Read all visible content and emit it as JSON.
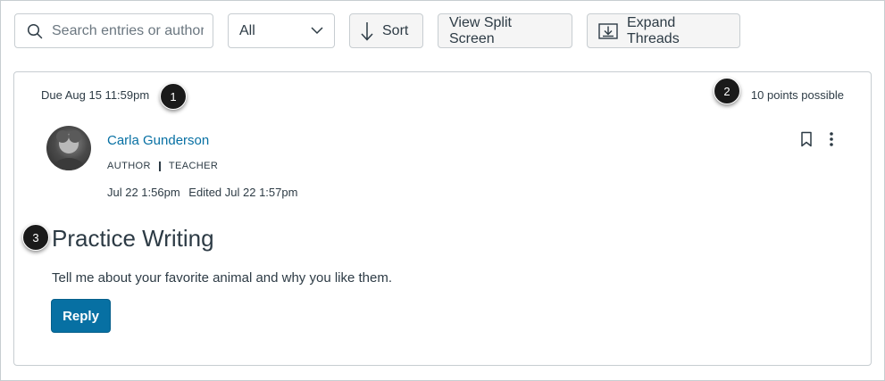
{
  "toolbar": {
    "search_placeholder": "Search entries or author",
    "filter_value": "All",
    "sort_label": "Sort",
    "split_label": "View Split Screen",
    "expand_label": "Expand Threads"
  },
  "topic": {
    "due": "Due Aug 15 11:59pm",
    "points": "10 points possible",
    "author_name": "Carla Gunderson",
    "role_author": "AUTHOR",
    "role_teacher": "TEACHER",
    "posted": "Jul 22 1:56pm",
    "edited": "Edited Jul 22 1:57pm",
    "title": "Practice Writing",
    "message": "Tell me about your favorite animal and why you like them.",
    "reply_label": "Reply"
  },
  "callouts": [
    "1",
    "2",
    "3"
  ],
  "colors": {
    "accent": "#0770a3",
    "text": "#2d3b45",
    "border": "#c7cdd1",
    "button_bg": "#f5f5f5"
  },
  "icons": {
    "search": "search-icon",
    "chevron": "chevron-down-icon",
    "sort": "arrow-down-icon",
    "expand": "expand-threads-icon",
    "bookmark": "bookmark-icon",
    "more": "more-vertical-icon"
  }
}
